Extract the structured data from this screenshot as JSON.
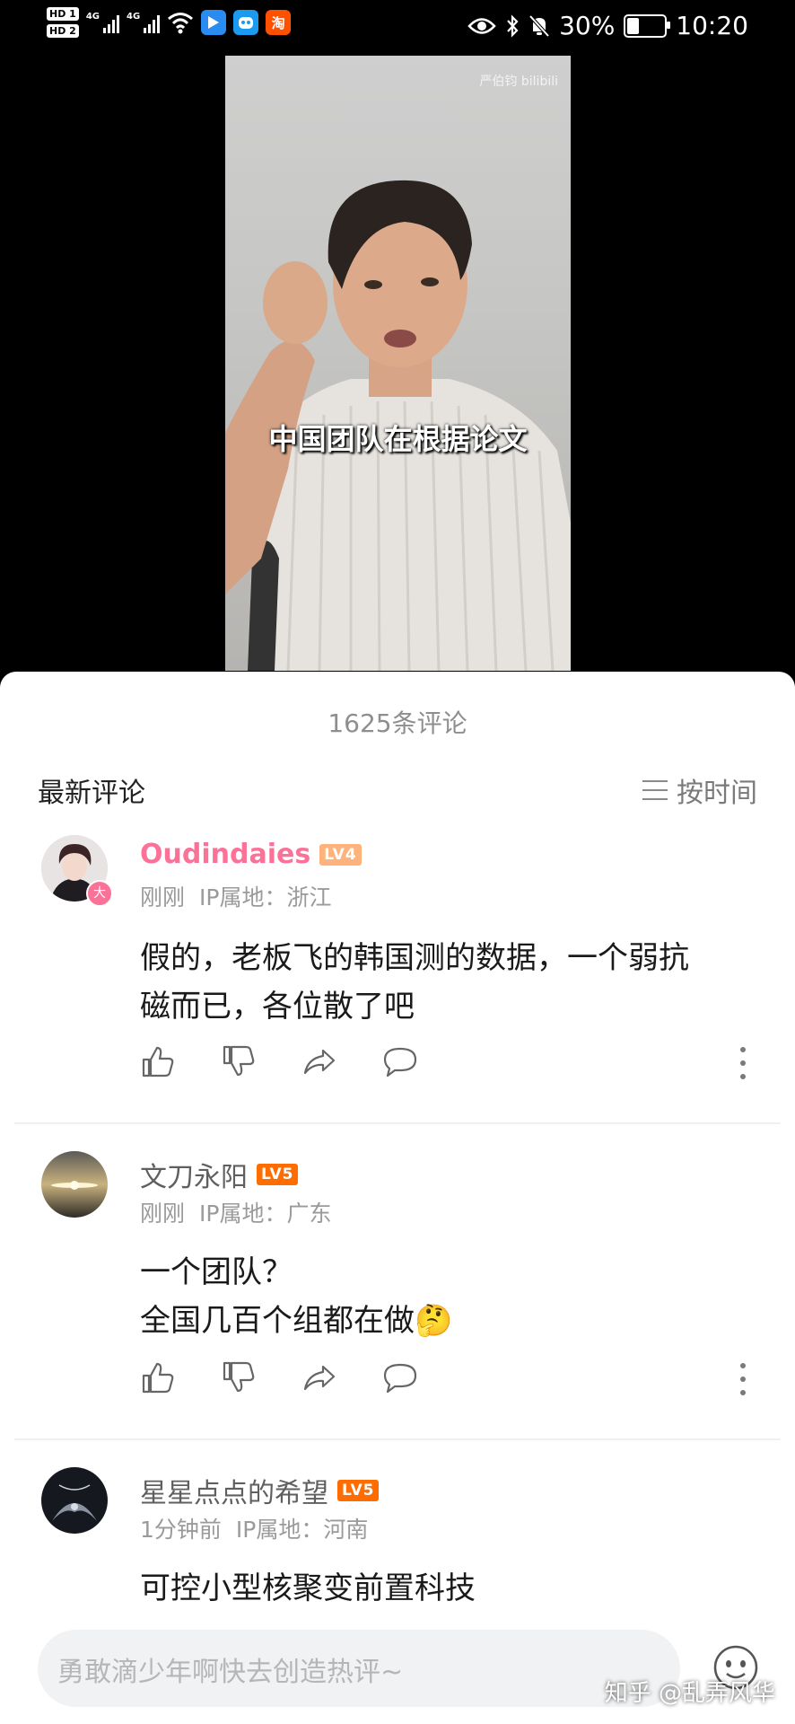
{
  "status_bar": {
    "hd1": "HD 1",
    "hd2": "HD 2",
    "net1": "4G",
    "net2": "4G",
    "app_taobao": "淘",
    "battery": "30%",
    "time": "10:20"
  },
  "video": {
    "watermark": "严伯钧 bilibili",
    "subtitle": "中国团队在根据论文"
  },
  "comments_panel": {
    "count_label": "1625条评论",
    "latest_label": "最新评论",
    "sort_label": "按时间"
  },
  "comments": [
    {
      "username": "Oudindaies",
      "level": "LV4",
      "avatar_badge": "大",
      "time": "刚刚",
      "ip": "IP属地：浙江",
      "text_lines": [
        "假的，老板飞的韩国测的数据，一个弱抗",
        "磁而已，各位散了吧"
      ]
    },
    {
      "username": "文刀永阳",
      "level": "LV5",
      "time": "刚刚",
      "ip": "IP属地：广东",
      "text_lines": [
        "一个团队？",
        "全国几百个组都在做🤔"
      ]
    },
    {
      "username": "星星点点的希望",
      "level": "LV5",
      "time": "1分钟前",
      "ip": "IP属地：河南",
      "text_lines": [
        "可控小型核聚变前置科技"
      ]
    }
  ],
  "input_bar": {
    "placeholder": "勇敢滴少年啊快去创造热评~",
    "watermark": "知乎 @乱弄风华"
  },
  "colors": {
    "vip_pink": "#fb7299",
    "lv4": "#ffb37c",
    "lv5": "#ff6c00"
  }
}
